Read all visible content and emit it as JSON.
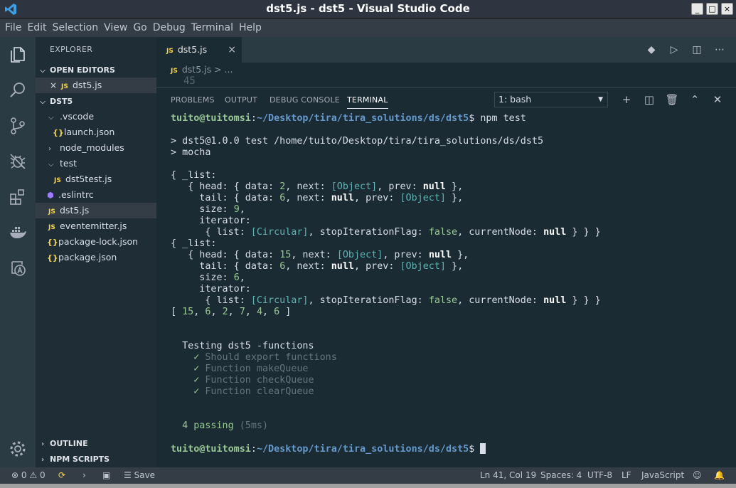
{
  "window": {
    "title": "dst5.js - dst5 - Visual Studio Code",
    "buttons": [
      "_",
      "□",
      "×"
    ]
  },
  "menu": [
    "File",
    "Edit",
    "Selection",
    "View",
    "Go",
    "Debug",
    "Terminal",
    "Help"
  ],
  "activity": [
    {
      "name": "files-icon"
    },
    {
      "name": "search-icon"
    },
    {
      "name": "source-control-icon"
    },
    {
      "name": "debug-icon"
    },
    {
      "name": "extensions-icon"
    },
    {
      "name": "docker-icon"
    },
    {
      "name": "azure-icon"
    },
    {
      "name": "gear-icon"
    }
  ],
  "sidebar": {
    "title": "EXPLORER",
    "open_editors": {
      "label": "OPEN EDITORS",
      "items": [
        {
          "close": "×",
          "badge": "JS",
          "label": "dst5.js"
        }
      ]
    },
    "folder": {
      "label": "DST5",
      "items": [
        {
          "label": ".vscode",
          "indent": 1,
          "icon": "chevron-down"
        },
        {
          "label": "launch.json",
          "indent": 2,
          "icon": "json"
        },
        {
          "label": "node_modules",
          "indent": 1,
          "icon": "chevron-right"
        },
        {
          "label": "test",
          "indent": 1,
          "icon": "chevron-down"
        },
        {
          "label": "dst5test.js",
          "indent": 2,
          "icon": "js"
        },
        {
          "label": ".eslintrc",
          "indent": 1,
          "icon": "eslint"
        },
        {
          "label": "dst5.js",
          "indent": 1,
          "icon": "js",
          "active": true
        },
        {
          "label": "eventemitter.js",
          "indent": 1,
          "icon": "js"
        },
        {
          "label": "package-lock.json",
          "indent": 1,
          "icon": "json"
        },
        {
          "label": "package.json",
          "indent": 1,
          "icon": "json"
        }
      ]
    },
    "outline": "OUTLINE",
    "npm_scripts": "NPM SCRIPTS"
  },
  "editor": {
    "tab": {
      "badge": "JS",
      "label": "dst5.js",
      "close": "×"
    },
    "breadcrumb": {
      "badge": "JS",
      "file": "dst5.js",
      "more": "> ..."
    },
    "ghost_line": "45"
  },
  "panel": {
    "tabs": [
      "PROBLEMS",
      "OUTPUT",
      "DEBUG CONSOLE",
      "TERMINAL"
    ],
    "active_tab": "TERMINAL",
    "terminal_select": "1: bash"
  },
  "terminal": {
    "user": "tuito@tuitomsi",
    "path": "~/Desktop/tira/tira_solutions/ds/dst5",
    "command": "npm test",
    "lines": [
      [
        {
          "t": "user",
          "s": "tuito@tuitomsi"
        },
        {
          "t": "n",
          "s": ":"
        },
        {
          "t": "path",
          "s": "~/Desktop/tira/tira_solutions/ds/dst5"
        },
        {
          "t": "n",
          "s": "$ npm test"
        }
      ],
      [],
      [
        {
          "t": "n",
          "s": "> dst5@1.0.0 test /home/tuito/Desktop/tira/tira_solutions/ds/dst5"
        }
      ],
      [
        {
          "t": "n",
          "s": "> mocha"
        }
      ],
      [],
      [
        {
          "t": "n",
          "s": "{ _list:"
        }
      ],
      [
        {
          "t": "n",
          "s": "   { head: { data: "
        },
        {
          "t": "gn",
          "s": "2"
        },
        {
          "t": "n",
          "s": ", next: "
        },
        {
          "t": "cy",
          "s": "[Object]"
        },
        {
          "t": "n",
          "s": ", prev: "
        },
        {
          "t": "bd",
          "s": "null"
        },
        {
          "t": "n",
          "s": " },"
        }
      ],
      [
        {
          "t": "n",
          "s": "     tail: { data: "
        },
        {
          "t": "gn",
          "s": "6"
        },
        {
          "t": "n",
          "s": ", next: "
        },
        {
          "t": "bd",
          "s": "null"
        },
        {
          "t": "n",
          "s": ", prev: "
        },
        {
          "t": "cy",
          "s": "[Object]"
        },
        {
          "t": "n",
          "s": " },"
        }
      ],
      [
        {
          "t": "n",
          "s": "     size: "
        },
        {
          "t": "gn",
          "s": "9"
        },
        {
          "t": "n",
          "s": ","
        }
      ],
      [
        {
          "t": "n",
          "s": "     iterator:"
        }
      ],
      [
        {
          "t": "n",
          "s": "      { list: "
        },
        {
          "t": "cy",
          "s": "[Circular]"
        },
        {
          "t": "n",
          "s": ", stopIterationFlag: "
        },
        {
          "t": "gn",
          "s": "false"
        },
        {
          "t": "n",
          "s": ", currentNode: "
        },
        {
          "t": "bd",
          "s": "null"
        },
        {
          "t": "n",
          "s": " } } }"
        }
      ],
      [
        {
          "t": "n",
          "s": "{ _list:"
        }
      ],
      [
        {
          "t": "n",
          "s": "   { head: { data: "
        },
        {
          "t": "gn",
          "s": "15"
        },
        {
          "t": "n",
          "s": ", next: "
        },
        {
          "t": "cy",
          "s": "[Object]"
        },
        {
          "t": "n",
          "s": ", prev: "
        },
        {
          "t": "bd",
          "s": "null"
        },
        {
          "t": "n",
          "s": " },"
        }
      ],
      [
        {
          "t": "n",
          "s": "     tail: { data: "
        },
        {
          "t": "gn",
          "s": "6"
        },
        {
          "t": "n",
          "s": ", next: "
        },
        {
          "t": "bd",
          "s": "null"
        },
        {
          "t": "n",
          "s": ", prev: "
        },
        {
          "t": "cy",
          "s": "[Object]"
        },
        {
          "t": "n",
          "s": " },"
        }
      ],
      [
        {
          "t": "n",
          "s": "     size: "
        },
        {
          "t": "gn",
          "s": "6"
        },
        {
          "t": "n",
          "s": ","
        }
      ],
      [
        {
          "t": "n",
          "s": "     iterator:"
        }
      ],
      [
        {
          "t": "n",
          "s": "      { list: "
        },
        {
          "t": "cy",
          "s": "[Circular]"
        },
        {
          "t": "n",
          "s": ", stopIterationFlag: "
        },
        {
          "t": "gn",
          "s": "false"
        },
        {
          "t": "n",
          "s": ", currentNode: "
        },
        {
          "t": "bd",
          "s": "null"
        },
        {
          "t": "n",
          "s": " } } }"
        }
      ],
      [
        {
          "t": "n",
          "s": "[ "
        },
        {
          "t": "gn",
          "s": "15"
        },
        {
          "t": "n",
          "s": ", "
        },
        {
          "t": "gn",
          "s": "6"
        },
        {
          "t": "n",
          "s": ", "
        },
        {
          "t": "gn",
          "s": "2"
        },
        {
          "t": "n",
          "s": ", "
        },
        {
          "t": "gn",
          "s": "7"
        },
        {
          "t": "n",
          "s": ", "
        },
        {
          "t": "gn",
          "s": "4"
        },
        {
          "t": "n",
          "s": ", "
        },
        {
          "t": "gn",
          "s": "6"
        },
        {
          "t": "n",
          "s": " ]"
        }
      ],
      [],
      [],
      [
        {
          "t": "n",
          "s": "  Testing dst5 -functions"
        }
      ],
      [
        {
          "t": "gn",
          "s": "    ✓ "
        },
        {
          "t": "dim",
          "s": "Should export functions"
        }
      ],
      [
        {
          "t": "gn",
          "s": "    ✓ "
        },
        {
          "t": "dim",
          "s": "Function makeQueue"
        }
      ],
      [
        {
          "t": "gn",
          "s": "    ✓ "
        },
        {
          "t": "dim",
          "s": "Function checkQueue"
        }
      ],
      [
        {
          "t": "gn",
          "s": "    ✓ "
        },
        {
          "t": "dim",
          "s": "Function clearQueue"
        }
      ],
      [],
      [],
      [
        {
          "t": "gn",
          "s": "  4 passing "
        },
        {
          "t": "dim",
          "s": "(5ms)"
        }
      ],
      [],
      [
        {
          "t": "user",
          "s": "tuito@tuitomsi"
        },
        {
          "t": "n",
          "s": ":"
        },
        {
          "t": "path",
          "s": "~/Desktop/tira/tira_solutions/ds/dst5"
        },
        {
          "t": "n",
          "s": "$ "
        },
        {
          "t": "cursor",
          "s": ""
        }
      ]
    ]
  },
  "status": {
    "errors": "0",
    "warnings": "0",
    "sync_icon": "sync-icon",
    "save": "Save",
    "position": "Ln 41, Col 19",
    "spaces": "Spaces: 4",
    "encoding": "UTF-8",
    "eol": "LF",
    "language": "JavaScript"
  },
  "colors": {
    "background": "#1b2b34",
    "sidebar": "#1f2d36",
    "accent_yellow": "#f7d44c",
    "prompt_user": "#99c794",
    "prompt_path": "#6699cc",
    "cyan": "#5fb3b3"
  }
}
